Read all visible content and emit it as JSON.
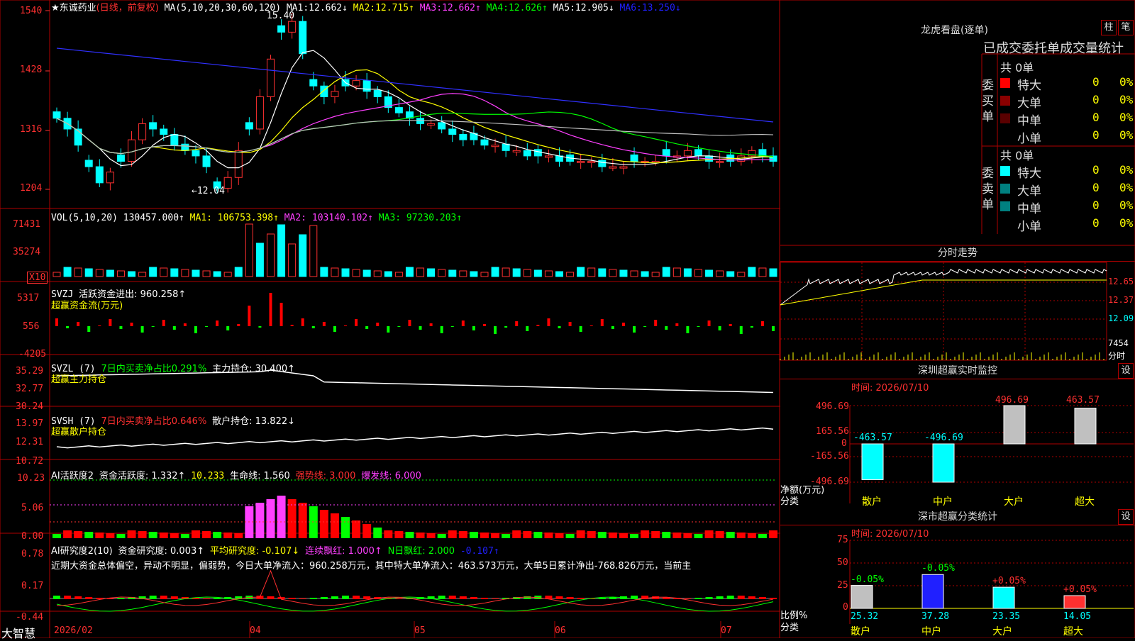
{
  "stock": {
    "name": "东诚药业",
    "star": "★",
    "mode": "(日线，前复权)",
    "ma_label": "MA(5,10,20,30,60,120)",
    "ma": [
      {
        "label": "MA1:",
        "value": "12.662↓",
        "color": "#ffffff"
      },
      {
        "label": "MA2:",
        "value": "12.715↑",
        "color": "#ffff00"
      },
      {
        "label": "MA3:",
        "value": "12.662↑",
        "color": "#ff40ff"
      },
      {
        "label": "MA4:",
        "value": "12.626↑",
        "color": "#00ff00"
      },
      {
        "label": "MA5:",
        "value": "12.905↓",
        "color": "#c0c0c0"
      },
      {
        "label": "MA6:",
        "value": "13.250↓",
        "color": "#3030ff"
      }
    ],
    "price_axis": [
      "1540",
      "1428",
      "1316",
      "1204"
    ],
    "high_label": "15.40",
    "low_label": "←12.04"
  },
  "vol": {
    "label": "VOL(5,10,20)",
    "value": "130457.000↑",
    "ma1": "MA1: 106753.398↑",
    "ma2": "MA2: 103140.102↑",
    "ma3": "MA3: 97230.203↑",
    "axis": [
      "71431",
      "35274"
    ],
    "unit": "X10"
  },
  "svzj": {
    "label": "SVZJ",
    "text": "活跃资金进出: 960.258↑",
    "sub": "超赢资金流(万元)",
    "axis": [
      "5317",
      "556",
      "-4205"
    ]
  },
  "svzl": {
    "label": "SVZL (7)",
    "text1": "7日内买卖净占比0.291%",
    "text2": "主力持仓: 30.400↑",
    "sub": "超赢主力持仓",
    "axis": [
      "35.29",
      "32.77",
      "30.24"
    ]
  },
  "svsh": {
    "label": "SVSH (7)",
    "text1": "7日内买卖净占比0.646%",
    "text2": "散户持仓: 13.822↓",
    "sub": "超赢散户持仓",
    "axis": [
      "13.97",
      "12.31",
      "10.72"
    ]
  },
  "ai_active": {
    "label": "AI活跃度2",
    "t1": "资金活跃度: 1.332↑",
    "t2": "10.233",
    "t3": "生命线: 1.560",
    "t4": "强势线: 3.000",
    "t5": "爆发线: 6.000",
    "axis": [
      "10.23",
      "5.06",
      "0.00"
    ]
  },
  "ai_research": {
    "label": "AI研究度2(10)",
    "t1": "资金研究度: 0.003↑",
    "t2": "平均研究度: -0.107↓",
    "t3": "连续飘红: 1.000↑",
    "t4": "N日飘红: 2.000",
    "t5": "-0.107↑",
    "comment": "近期大资金总体偏空，异动不明显，偏弱势，今日大单净流入：960.258万元，其中特大单净流入：463.573万元，大单5日累计净出-768.826万元，当前主",
    "axis": [
      "0.78",
      "0.17",
      "-0.44"
    ]
  },
  "bottom_axis": {
    "brand": "大智慧",
    "labels": [
      "2026/02",
      "04",
      "05",
      "06",
      "07"
    ]
  },
  "right": {
    "dragon_title": "龙虎看盘(逐单)",
    "btn_col": "柱",
    "btn_bi": "笔",
    "table_title": "已成交委托单成交量统计",
    "buy_side": "委买单",
    "sell_side": "委卖单",
    "total_label": "共 0单",
    "rows": [
      {
        "name": "特大",
        "n": "0",
        "pct": "0%"
      },
      {
        "name": "大单",
        "n": "0",
        "pct": "0%"
      },
      {
        "name": "中单",
        "n": "0",
        "pct": "0%"
      },
      {
        "name": "小单",
        "n": "0",
        "pct": "0%"
      }
    ],
    "buy_colors": [
      "#ff0000",
      "#8b0000",
      "#5a0000",
      ""
    ],
    "sell_colors": [
      "#00ffff",
      "#008080",
      "#008080",
      ""
    ],
    "minute_title": "分时走势",
    "minute_axis": [
      "12.65",
      "12.37",
      "12.09",
      "7454"
    ],
    "minute_unit": "分时",
    "sz_title": "深圳超赢实时监控",
    "sz_set": "设",
    "sz_time": "时间: 2026/07/10",
    "sz_axis": [
      "496.69",
      "165.56",
      "0",
      "-165.56",
      "-496.69"
    ],
    "sz_ylabel": "净额(万元)",
    "sz_xlabel": "分类",
    "sz_cats": [
      "散户",
      "中户",
      "大户",
      "超大"
    ],
    "sz_values": [
      "-463.57",
      "-496.69",
      "496.69",
      "463.57"
    ],
    "cls_title": "深市超赢分类统计",
    "cls_set": "设",
    "cls_time": "时间: 2026/07/10",
    "cls_axis": [
      "75",
      "50",
      "25",
      "0"
    ],
    "cls_ylabel": "比例%",
    "cls_xlabel": "分类",
    "cls_cats": [
      "散户",
      "中户",
      "大户",
      "超大"
    ],
    "cls_changes": [
      "-0.05%",
      "-0.05%",
      "+0.05%",
      "+0.05%"
    ],
    "cls_values": [
      "25.32",
      "37.28",
      "23.35",
      "14.05"
    ]
  },
  "chart_data": {
    "type": "candlestick",
    "title": "东诚药业",
    "x_axis": [
      "2026/02",
      "04",
      "05",
      "06",
      "07"
    ],
    "ylim": [
      12.04,
      15.4
    ],
    "close_approx": [
      13.4,
      13.2,
      12.9,
      12.5,
      12.2,
      12.4,
      12.6,
      13.0,
      13.3,
      13.2,
      13.1,
      12.9,
      12.8,
      12.7,
      12.5,
      12.1,
      12.3,
      12.8,
      13.2,
      13.8,
      14.5,
      15.0,
      15.2,
      14.6,
      14.0,
      13.8,
      13.9,
      14.0,
      14.1,
      13.9,
      13.8,
      13.6,
      13.5,
      13.4,
      13.3,
      13.3,
      13.2,
      13.1,
      13.0,
      13.0,
      12.9,
      12.9,
      12.8,
      12.8,
      12.7,
      12.7,
      12.7,
      12.6,
      12.6,
      12.6,
      12.6,
      12.5,
      12.5,
      12.5,
      12.6,
      12.6,
      12.6,
      12.7,
      12.7,
      12.8,
      12.7,
      12.6,
      12.6,
      12.6,
      12.7,
      12.8,
      12.7,
      12.6
    ],
    "sz_monitor": {
      "categories": [
        "散户",
        "中户",
        "大户",
        "超大"
      ],
      "values": [
        -463.57,
        -496.69,
        496.69,
        463.57
      ]
    },
    "sz_classify": {
      "categories": [
        "散户",
        "中户",
        "大户",
        "超大"
      ],
      "values": [
        25.32,
        37.28,
        23.35,
        14.05
      ]
    }
  }
}
